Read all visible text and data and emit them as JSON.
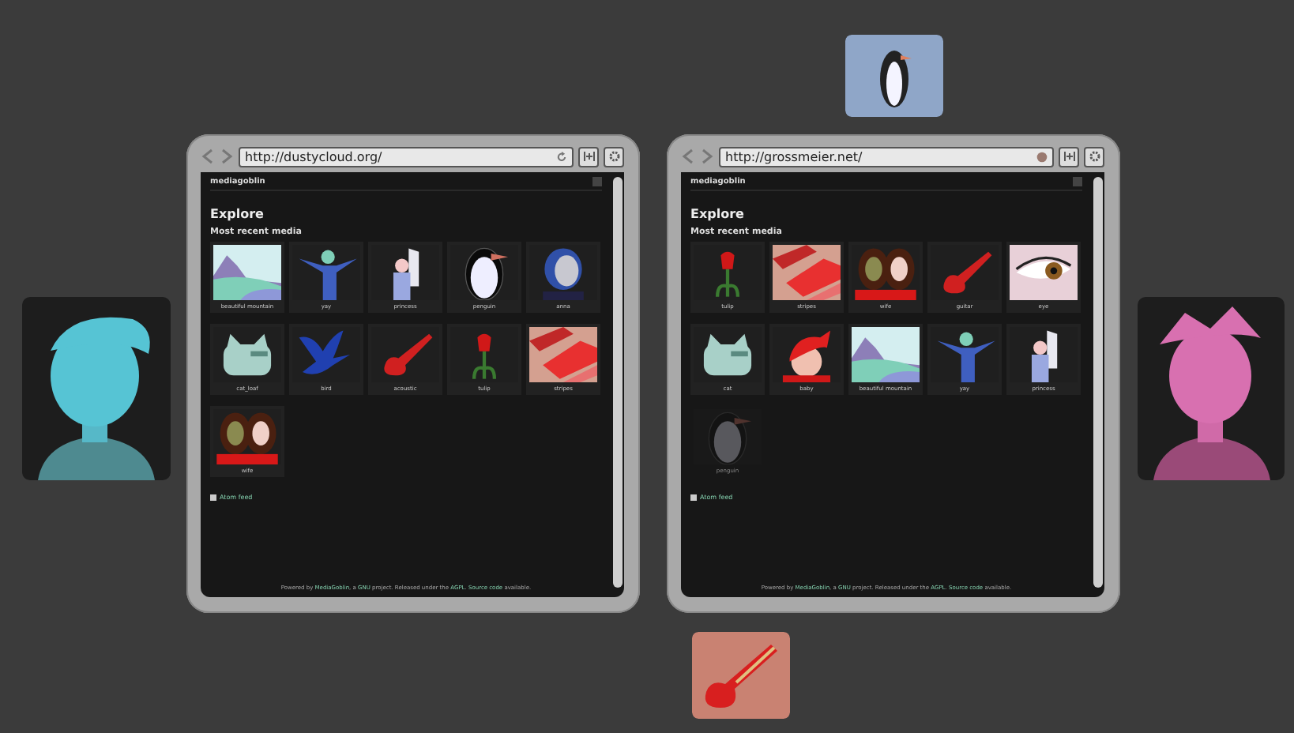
{
  "browsers": [
    {
      "url": "http://dustycloud.org/",
      "loading": false,
      "site_name": "mediagoblin",
      "heading": "Explore",
      "subheading": "Most recent media",
      "media": [
        {
          "kind": "mountain",
          "caption": "beautiful mountain",
          "faded": false
        },
        {
          "kind": "figure",
          "caption": "yay",
          "faded": false
        },
        {
          "kind": "princess",
          "caption": "princess",
          "faded": false
        },
        {
          "kind": "penguin",
          "caption": "penguin",
          "faded": false
        },
        {
          "kind": "portrait",
          "caption": "anna",
          "faded": false
        },
        {
          "kind": "cat",
          "caption": "cat_loaf",
          "faded": false
        },
        {
          "kind": "bird",
          "caption": "bird",
          "faded": false
        },
        {
          "kind": "guitar",
          "caption": "acoustic",
          "faded": false
        },
        {
          "kind": "tulip",
          "caption": "tulip",
          "faded": false
        },
        {
          "kind": "stripes",
          "caption": "stripes",
          "faded": false
        },
        {
          "kind": "women",
          "caption": "wife",
          "faded": false
        }
      ],
      "feed_link": "Atom feed",
      "footer": "Powered by **MediaGoblin**, a **GNU** project. Released under the **AGPL**. **Source code** available."
    },
    {
      "url": "http://grossmeier.net/",
      "loading": true,
      "site_name": "mediagoblin",
      "heading": "Explore",
      "subheading": "Most recent media",
      "media": [
        {
          "kind": "tulip",
          "caption": "tulip",
          "faded": false
        },
        {
          "kind": "stripes",
          "caption": "stripes",
          "faded": false
        },
        {
          "kind": "women",
          "caption": "wife",
          "faded": false
        },
        {
          "kind": "guitar",
          "caption": "guitar",
          "faded": false
        },
        {
          "kind": "eye",
          "caption": "eye",
          "faded": false
        },
        {
          "kind": "cat",
          "caption": "cat",
          "faded": false
        },
        {
          "kind": "baby",
          "caption": "baby",
          "faded": false
        },
        {
          "kind": "mountain",
          "caption": "beautiful mountain",
          "faded": false
        },
        {
          "kind": "figure",
          "caption": "yay",
          "faded": false
        },
        {
          "kind": "princess",
          "caption": "princess",
          "faded": false
        },
        {
          "kind": "penguin",
          "caption": "penguin",
          "faded": true
        }
      ],
      "feed_link": "Atom feed",
      "footer": "Powered by **MediaGoblin**, a **GNU** project. Released under the **AGPL**. **Source code** available."
    }
  ]
}
